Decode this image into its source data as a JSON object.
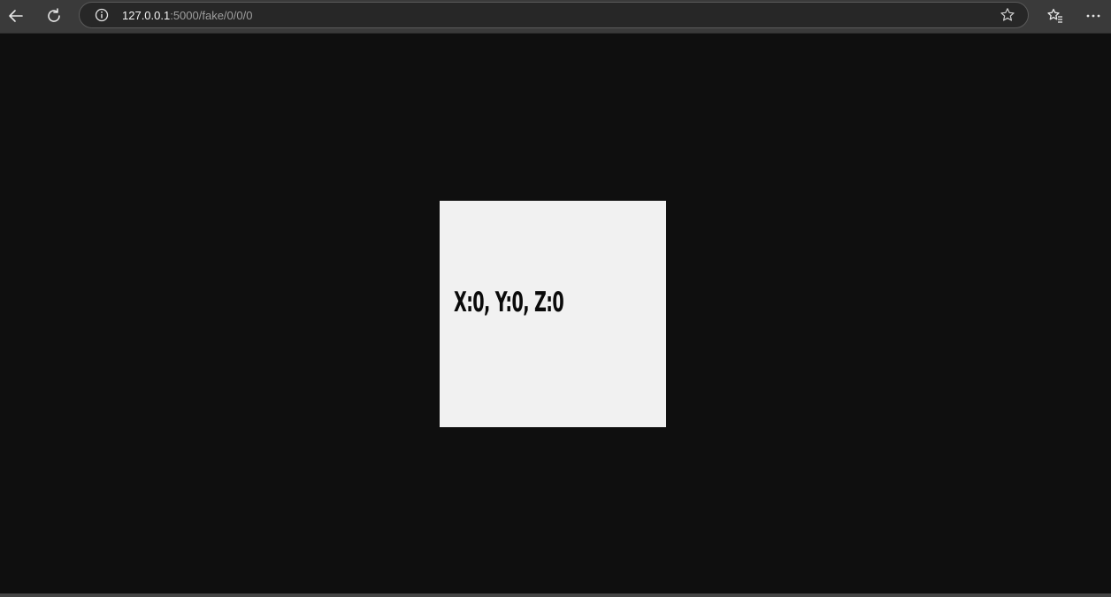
{
  "browser": {
    "url_host": "127.0.0.1",
    "url_path": ":5000/fake/0/0/0",
    "icons": {
      "back": "back-arrow-icon",
      "reload": "reload-icon",
      "info": "info-icon",
      "star": "star-icon",
      "favorites": "favorites-icon",
      "more": "more-icon"
    }
  },
  "page": {
    "coordinates_text": "X:0, Y:0, Z:0"
  },
  "colors": {
    "page_background": "#0f0f0f",
    "card_background": "#f1f1f1",
    "chrome_background": "#3a3a3a"
  }
}
